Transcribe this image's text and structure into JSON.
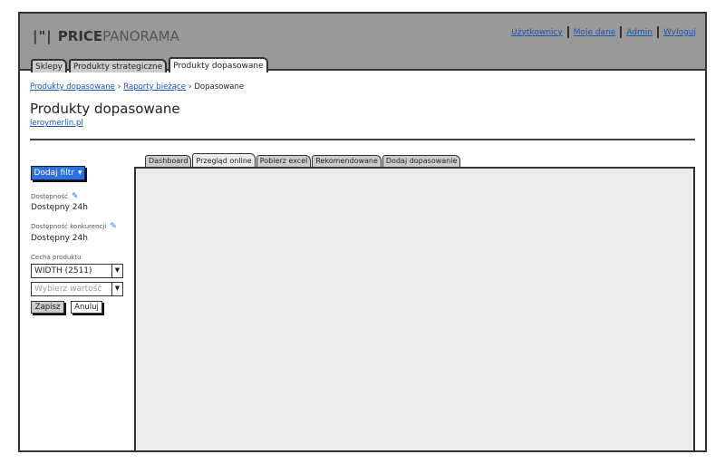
{
  "header": {
    "logo_bold": "PRICE",
    "logo_light": "PANORAMA",
    "links": [
      "Użytkownicy",
      "Moje dane",
      "Admin",
      "Wyloguj"
    ]
  },
  "main_tabs": [
    "Sklepy",
    "Produkty strategiczne",
    "Produkty dopasowane"
  ],
  "breadcrumb": [
    "Produkty dopasowane",
    "Raporty bieżące",
    "Dopasowane"
  ],
  "page": {
    "title": "Produkty dopasowane",
    "subtitle_link": "leroymerlin.pl"
  },
  "filters": {
    "add_filter": "Dodaj filtr",
    "availability_label": "Dostępność",
    "availability_value": "Dostępny 24h",
    "competitor_label": "Dostępność konkurencji",
    "competitor_value": "Dostępny 24h",
    "feature_label": "Cecha produktu",
    "feature_value": "WIDTH (2511)",
    "value_placeholder": "Wybierz wartość",
    "save": "Zapisz",
    "cancel": "Anuluj"
  },
  "content_tabs": [
    "Dashboard",
    "Przegląd online",
    "Pobierz excel",
    "Rekomendowane",
    "Dodaj dopasowanie"
  ]
}
